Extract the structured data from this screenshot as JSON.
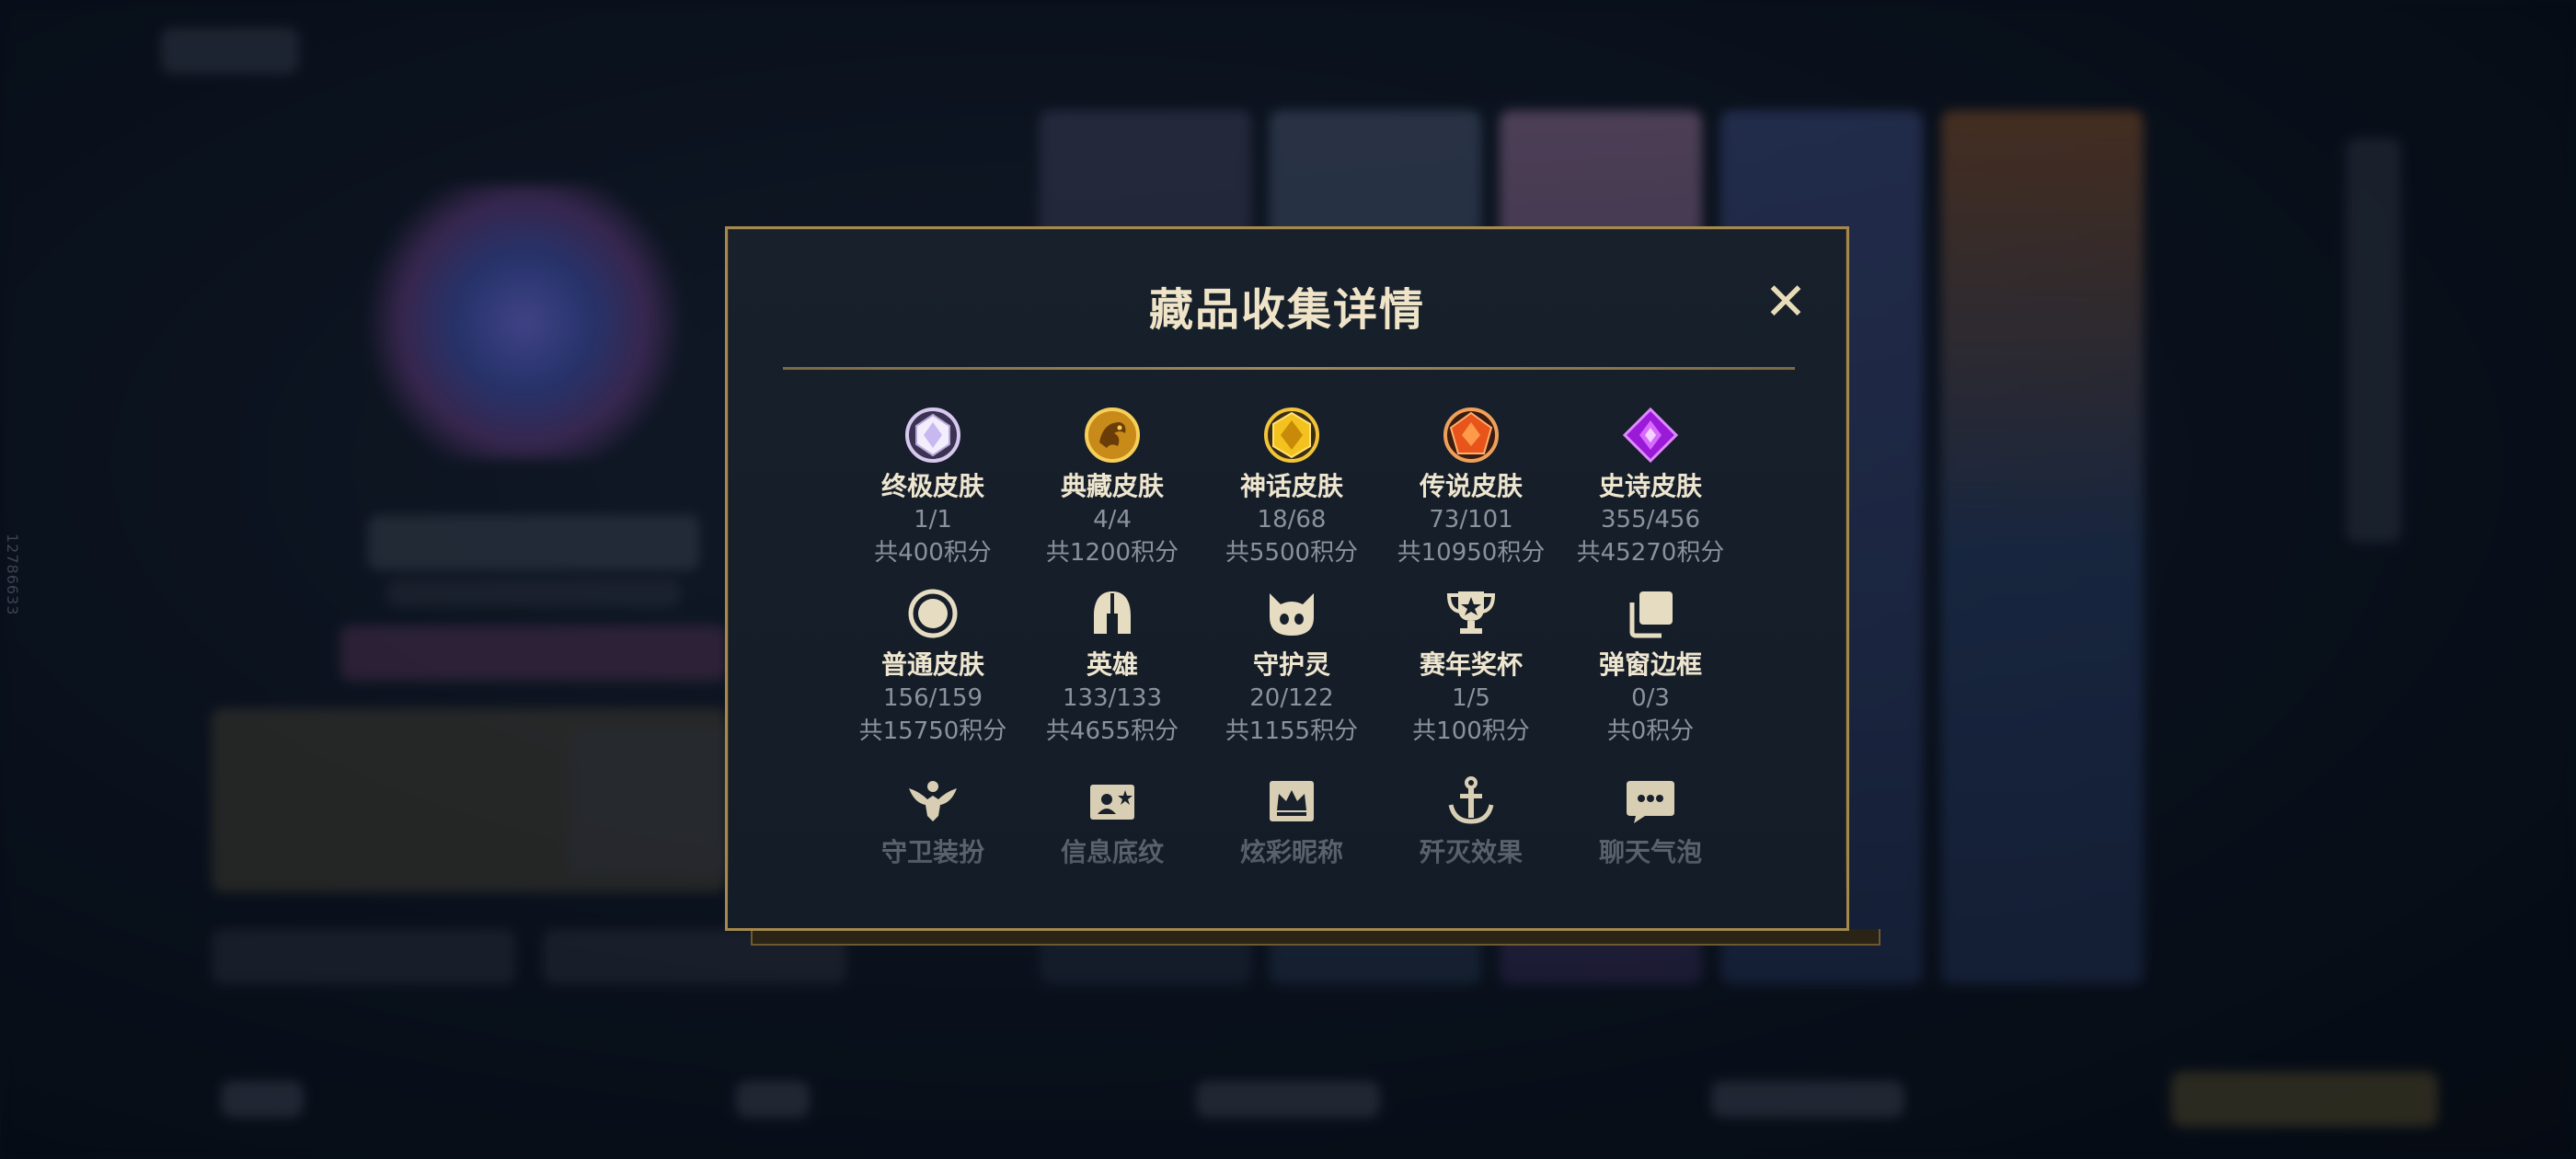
{
  "build_id": "12786633",
  "modal": {
    "title": "藏品收集详情",
    "close_label": "✕",
    "rows": [
      [
        {
          "label": "终极皮肤",
          "count": "1/1",
          "points": "共400积分",
          "icon": "ultimate-gem-icon"
        },
        {
          "label": "典藏皮肤",
          "count": "4/4",
          "points": "共1200积分",
          "icon": "dragon-medal-icon"
        },
        {
          "label": "神话皮肤",
          "count": "18/68",
          "points": "共5500积分",
          "icon": "mythic-gem-icon"
        },
        {
          "label": "传说皮肤",
          "count": "73/101",
          "points": "共10950积分",
          "icon": "legendary-gem-icon"
        },
        {
          "label": "史诗皮肤",
          "count": "355/456",
          "points": "共45270积分",
          "icon": "epic-gem-icon"
        }
      ],
      [
        {
          "label": "普通皮肤",
          "count": "156/159",
          "points": "共15750积分",
          "icon": "circle-icon"
        },
        {
          "label": "英雄",
          "count": "133/133",
          "points": "共4655积分",
          "icon": "helmet-icon"
        },
        {
          "label": "守护灵",
          "count": "20/122",
          "points": "共1155积分",
          "icon": "guardian-face-icon"
        },
        {
          "label": "赛年奖杯",
          "count": "1/5",
          "points": "共100积分",
          "icon": "trophy-icon"
        },
        {
          "label": "弹窗边框",
          "count": "0/3",
          "points": "共0积分",
          "icon": "stacked-frames-icon"
        }
      ],
      [
        {
          "label": "守卫装扮",
          "icon": "winged-figure-icon"
        },
        {
          "label": "信息底纹",
          "icon": "profile-card-icon"
        },
        {
          "label": "炫彩昵称",
          "icon": "crown-tag-icon"
        },
        {
          "label": "歼灭效果",
          "icon": "anchor-icon"
        },
        {
          "label": "聊天气泡",
          "icon": "chat-bubble-icon"
        }
      ]
    ]
  },
  "colors": {
    "gold_border": "#a4884c",
    "title": "#efe4c8",
    "muted": "#8a929c",
    "panel": "#17202b"
  }
}
